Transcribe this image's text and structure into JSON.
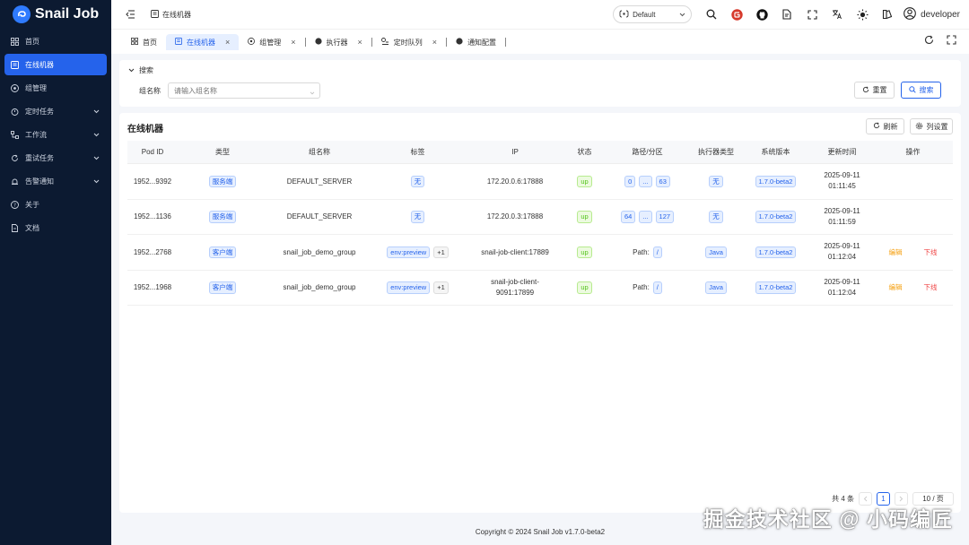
{
  "app": {
    "name": "Snail Job"
  },
  "sidebar": {
    "items": [
      {
        "label": "首页",
        "icon": "dashboard-icon"
      },
      {
        "label": "在线机器",
        "icon": "list-icon",
        "active": true
      },
      {
        "label": "组管理",
        "icon": "group-icon"
      },
      {
        "label": "定时任务",
        "icon": "timer-icon",
        "expandable": true
      },
      {
        "label": "工作流",
        "icon": "workflow-icon",
        "expandable": true
      },
      {
        "label": "重试任务",
        "icon": "retry-icon",
        "expandable": true
      },
      {
        "label": "告警通知",
        "icon": "alarm-icon",
        "expandable": true
      },
      {
        "label": "关于",
        "icon": "question-icon"
      },
      {
        "label": "文档",
        "icon": "doc-icon"
      }
    ]
  },
  "header": {
    "breadcrumb": "在线机器",
    "theme": "Default",
    "user": "developer"
  },
  "tabs": [
    {
      "label": "首页",
      "closable": false
    },
    {
      "label": "在线机器",
      "closable": true,
      "active": true
    },
    {
      "label": "组管理",
      "closable": true
    },
    {
      "label": "执行器",
      "closable": true
    },
    {
      "label": "定时队列",
      "closable": true
    },
    {
      "label": "通知配置",
      "closable": false
    }
  ],
  "search": {
    "title": "搜索",
    "group_label": "组名称",
    "group_placeholder": "请输入组名称",
    "reset_label": "重置",
    "search_label": "搜索"
  },
  "table": {
    "title": "在线机器",
    "refresh_label": "刷新",
    "columns_label": "列设置",
    "columns": [
      "Pod ID",
      "类型",
      "组名称",
      "标签",
      "IP",
      "状态",
      "路径/分区",
      "执行器类型",
      "系统版本",
      "更新时间",
      "操作"
    ],
    "rows": [
      {
        "pod_id": "1952...9392",
        "type": "服务端",
        "group": "DEFAULT_SERVER",
        "labels": "无",
        "labels_extra": "",
        "ip": "172.20.0.6:17888",
        "ip2": "",
        "status": "up",
        "path_a": "0",
        "path_mid": "...",
        "path_b": "63",
        "path_prefix": "",
        "executor": "无",
        "version": "1.7.0-beta2",
        "date": "2025-09-11",
        "time": "01:11:45",
        "edit": "",
        "offline": ""
      },
      {
        "pod_id": "1952...1136",
        "type": "服务端",
        "group": "DEFAULT_SERVER",
        "labels": "无",
        "labels_extra": "",
        "ip": "172.20.0.3:17888",
        "ip2": "",
        "status": "up",
        "path_a": "64",
        "path_mid": "...",
        "path_b": "127",
        "path_prefix": "",
        "executor": "无",
        "version": "1.7.0-beta2",
        "date": "2025-09-11",
        "time": "01:11:59",
        "edit": "",
        "offline": ""
      },
      {
        "pod_id": "1952...2768",
        "type": "客户端",
        "group": "snail_job_demo_group",
        "labels": "env:preview",
        "labels_extra": "+1",
        "ip": "snail-job-client:17889",
        "ip2": "",
        "status": "up",
        "path_a": "",
        "path_mid": "",
        "path_b": "/",
        "path_prefix": "Path:",
        "executor": "Java",
        "version": "1.7.0-beta2",
        "date": "2025-09-11",
        "time": "01:12:04",
        "edit": "编辑",
        "offline": "下线"
      },
      {
        "pod_id": "1952...1968",
        "type": "客户端",
        "group": "snail_job_demo_group",
        "labels": "env:preview",
        "labels_extra": "+1",
        "ip": "snail-job-client-",
        "ip2": "9091:17899",
        "status": "up",
        "path_a": "",
        "path_mid": "",
        "path_b": "/",
        "path_prefix": "Path:",
        "executor": "Java",
        "version": "1.7.0-beta2",
        "date": "2025-09-11",
        "time": "01:12:04",
        "edit": "编辑",
        "offline": "下线"
      }
    ],
    "pagination": {
      "total_text": "共 4 条",
      "current_page": "1",
      "page_size": "10 / 页"
    }
  },
  "footer": {
    "text": "Copyright © 2024 Snail Job v1.7.0-beta2"
  },
  "watermark": "掘金技术社区 @ 小码编匠",
  "colors": {
    "sidebar_bg": "#0c1a31",
    "primary": "#2563eb",
    "success": "#52c41a",
    "warning": "#f59e0b",
    "danger": "#ef4444"
  }
}
